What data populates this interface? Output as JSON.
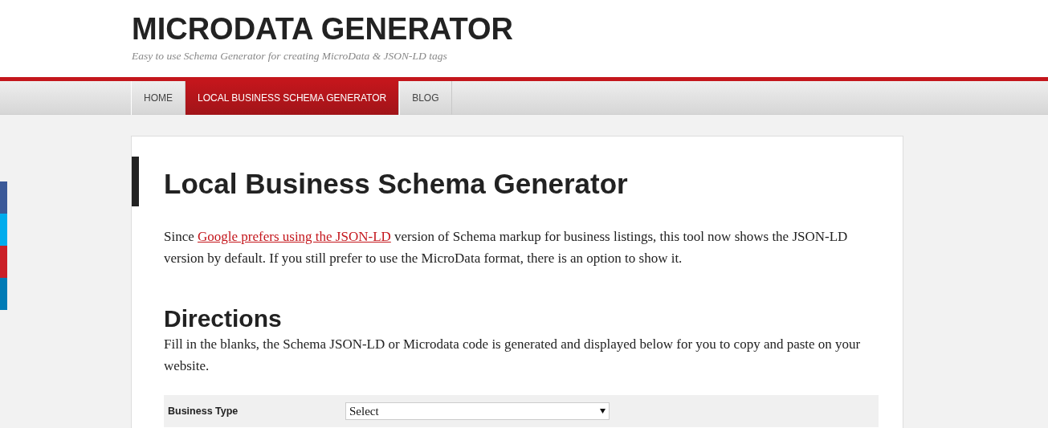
{
  "site": {
    "title": "MICRODATA GENERATOR",
    "tagline": "Easy to use Schema Generator for creating MicroData & JSON-LD tags"
  },
  "nav": [
    {
      "label": "HOME",
      "selected": false
    },
    {
      "label": "LOCAL BUSINESS SCHEMA GENERATOR",
      "selected": true
    },
    {
      "label": "BLOG",
      "selected": false
    }
  ],
  "social_buttons": [
    {
      "color": "#3b5998"
    },
    {
      "color": "#00aced"
    },
    {
      "color": "#cb2027"
    },
    {
      "color": "#007bb6"
    }
  ],
  "article": {
    "heading": "Local Business Schema Generator",
    "intro": {
      "before": "Since ",
      "link": "Google prefers using the JSON-LD",
      "after": " version of Schema markup for business listings, this tool now shows the JSON-LD version by default. If you still prefer to use the MicroData format, there is an option to show it."
    },
    "directions_heading": "Directions",
    "directions_text": "Fill in the blanks, the Schema JSON-LD or Microdata code is generated and displayed below for you to copy and paste on your website.",
    "form_rows": [
      {
        "label": "Business Type",
        "value": "Select"
      }
    ]
  }
}
